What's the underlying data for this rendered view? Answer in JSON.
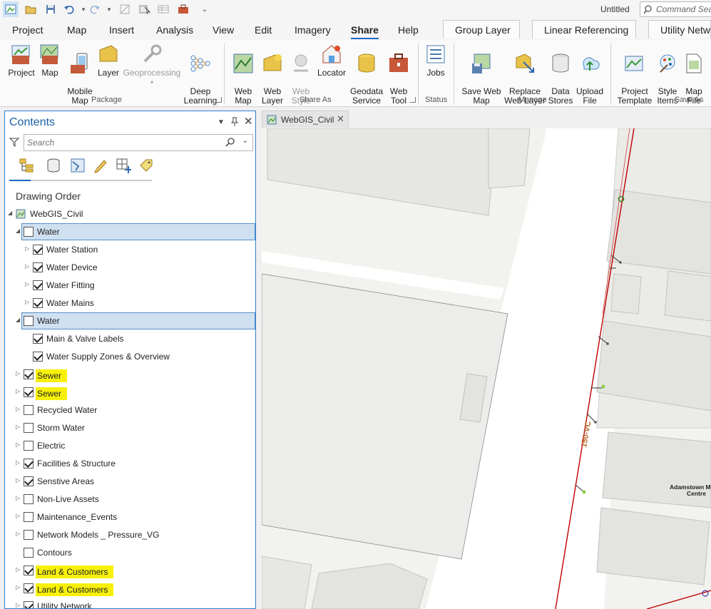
{
  "qat": {
    "title": "Untitled",
    "command_search_placeholder": "Command Search"
  },
  "tabs": [
    "Project",
    "Map",
    "Insert",
    "Analysis",
    "View",
    "Edit",
    "Imagery",
    "Share",
    "Help"
  ],
  "active_tab": "Share",
  "context_tabs": [
    "Group Layer",
    "Linear Referencing",
    "Utility Network"
  ],
  "ribbon": {
    "package": {
      "label": "Package",
      "buttons": [
        "Project",
        "Map",
        "Mobile\nMap",
        "Layer",
        "Geoprocessing",
        "Deep\nLearning"
      ]
    },
    "share_as": {
      "label": "Share As",
      "buttons": [
        "Web\nMap",
        "Web\nLayer",
        "Web\nStyle",
        "Locator",
        "Geodata\nService",
        "Web\nTool"
      ]
    },
    "status": {
      "label": "Status",
      "buttons": [
        "Jobs"
      ]
    },
    "manage": {
      "label": "Manage",
      "buttons": [
        "Save Web\nMap",
        "Replace\nWeb Layer",
        "Data\nStores",
        "Upload\nFile"
      ]
    },
    "save_as": {
      "label": "Save As",
      "buttons": [
        "Project\nTemplate",
        "Style\nItems",
        "Map\nFile"
      ]
    }
  },
  "contents": {
    "title": "Contents",
    "search_placeholder": "Search",
    "drawing_order": "Drawing Order",
    "map_name": "WebGIS_Civil",
    "layers": [
      {
        "label": "Water",
        "level": 1,
        "checked": false,
        "expanded": true,
        "selected": true,
        "highlight": false,
        "has_children": true
      },
      {
        "label": "Water Station",
        "level": 2,
        "checked": true,
        "expanded": false,
        "selected": false,
        "highlight": false,
        "has_children": true
      },
      {
        "label": "Water Device",
        "level": 2,
        "checked": true,
        "expanded": false,
        "selected": false,
        "highlight": false,
        "has_children": true
      },
      {
        "label": "Water Fitting",
        "level": 2,
        "checked": true,
        "expanded": false,
        "selected": false,
        "highlight": false,
        "has_children": true
      },
      {
        "label": "Water Mains",
        "level": 2,
        "checked": true,
        "expanded": false,
        "selected": false,
        "highlight": false,
        "has_children": true
      },
      {
        "label": "Water",
        "level": 1,
        "checked": false,
        "expanded": true,
        "selected": true,
        "highlight": false,
        "has_children": true
      },
      {
        "label": "Main & Valve Labels",
        "level": 2,
        "checked": true,
        "expanded": false,
        "selected": false,
        "highlight": false,
        "has_children": false
      },
      {
        "label": "Water Supply Zones & Overview",
        "level": 2,
        "checked": true,
        "expanded": false,
        "selected": false,
        "highlight": false,
        "has_children": false
      },
      {
        "label": "Sewer",
        "level": 1,
        "checked": true,
        "expanded": false,
        "selected": false,
        "highlight": true,
        "has_children": true
      },
      {
        "label": "Sewer",
        "level": 1,
        "checked": true,
        "expanded": false,
        "selected": false,
        "highlight": true,
        "has_children": true
      },
      {
        "label": "Recycled Water",
        "level": 1,
        "checked": false,
        "expanded": false,
        "selected": false,
        "highlight": false,
        "has_children": true
      },
      {
        "label": "Storm Water",
        "level": 1,
        "checked": false,
        "expanded": false,
        "selected": false,
        "highlight": false,
        "has_children": true
      },
      {
        "label": "Electric",
        "level": 1,
        "checked": false,
        "expanded": false,
        "selected": false,
        "highlight": false,
        "has_children": true
      },
      {
        "label": "Facilities & Structure",
        "level": 1,
        "checked": true,
        "expanded": false,
        "selected": false,
        "highlight": false,
        "has_children": true
      },
      {
        "label": "Senstive Areas",
        "level": 1,
        "checked": true,
        "expanded": false,
        "selected": false,
        "highlight": false,
        "has_children": true
      },
      {
        "label": "Non-Live Assets",
        "level": 1,
        "checked": false,
        "expanded": false,
        "selected": false,
        "highlight": false,
        "has_children": true
      },
      {
        "label": "Maintenance_Events",
        "level": 1,
        "checked": false,
        "expanded": false,
        "selected": false,
        "highlight": false,
        "has_children": true
      },
      {
        "label": "Network Models _ Pressure_VG",
        "level": 1,
        "checked": false,
        "expanded": false,
        "selected": false,
        "highlight": false,
        "has_children": true
      },
      {
        "label": "Contours",
        "level": 1,
        "checked": false,
        "expanded": false,
        "selected": false,
        "highlight": false,
        "has_children": false
      },
      {
        "label": "Land & Customers",
        "level": 1,
        "checked": true,
        "expanded": false,
        "selected": false,
        "highlight": true,
        "has_children": true
      },
      {
        "label": "Land & Customers",
        "level": 1,
        "checked": true,
        "expanded": false,
        "selected": false,
        "highlight": true,
        "has_children": true
      },
      {
        "label": "Utility Network",
        "level": 1,
        "checked": true,
        "expanded": false,
        "selected": false,
        "highlight": false,
        "has_children": true
      }
    ]
  },
  "map": {
    "tab_label": "WebGIS_Civil",
    "main_label": "150-VC",
    "place_label_line1": "Adamstown Me",
    "place_label_line2": "Centre"
  },
  "colors": {
    "accent": "#1a66c2",
    "highlight": "#f7f00a",
    "selection": "#cfe0f1",
    "main_line": "#c00000"
  }
}
